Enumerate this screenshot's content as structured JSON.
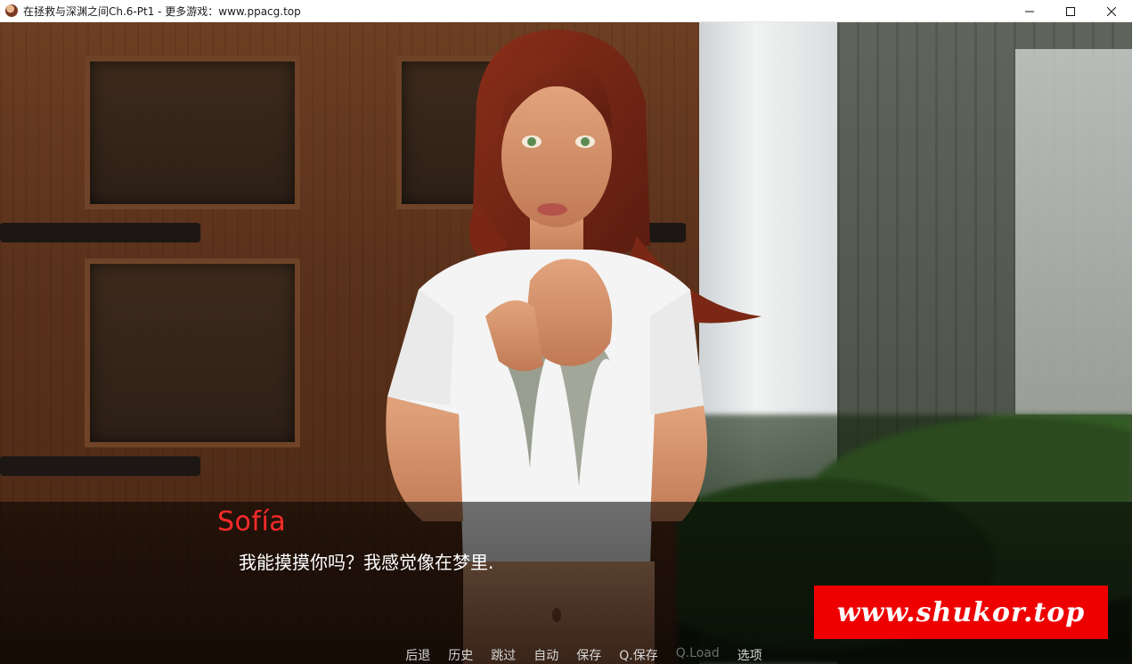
{
  "window": {
    "title": "在拯救与深渊之间Ch.6-Pt1 - 更多游戏：www.ppacg.top",
    "app_icon": "game-avatar-icon",
    "controls": [
      "minimize-icon",
      "maximize-icon",
      "close-icon"
    ]
  },
  "dialogue": {
    "speaker": "Sofía",
    "speaker_color": "#ff2a2a",
    "text": "我能摸摸你吗？我感觉像在梦里."
  },
  "watermark": {
    "text": "www.shukor.top",
    "color": "#ee0000"
  },
  "quick_menu": {
    "back": "后退",
    "history": "历史",
    "skip": "跳过",
    "auto": "自动",
    "save": "保存",
    "qsave": "Q.保存",
    "qload": "Q.Load",
    "prefs": "选项"
  }
}
